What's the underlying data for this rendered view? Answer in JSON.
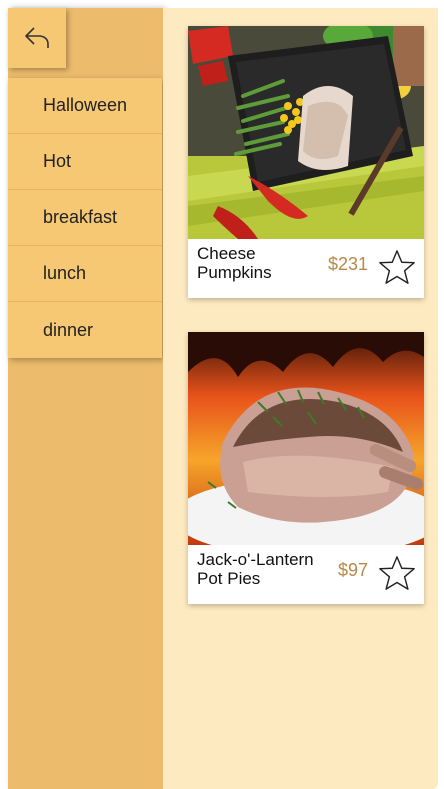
{
  "sidebar": {
    "back_icon": "back-arrow-icon",
    "items": [
      {
        "label": "Halloween"
      },
      {
        "label": "Hot"
      },
      {
        "label": "breakfast"
      },
      {
        "label": "lunch"
      },
      {
        "label": "dinner"
      }
    ]
  },
  "products": [
    {
      "title": "Cheese Pumpkins",
      "price": "$231",
      "image": "plated grilled chicken with green beans and corn",
      "favorite_icon": "star-outline-icon"
    },
    {
      "title": "Jack-o'-Lantern Pot Pies",
      "price": "$97",
      "image": "roasted rack of pork with flames behind",
      "favorite_icon": "star-outline-icon"
    }
  ],
  "colors": {
    "sidebar": "#ecbb6c",
    "menu_item": "#f7c874",
    "content_bg": "#feeac0",
    "price": "#b8894a"
  }
}
